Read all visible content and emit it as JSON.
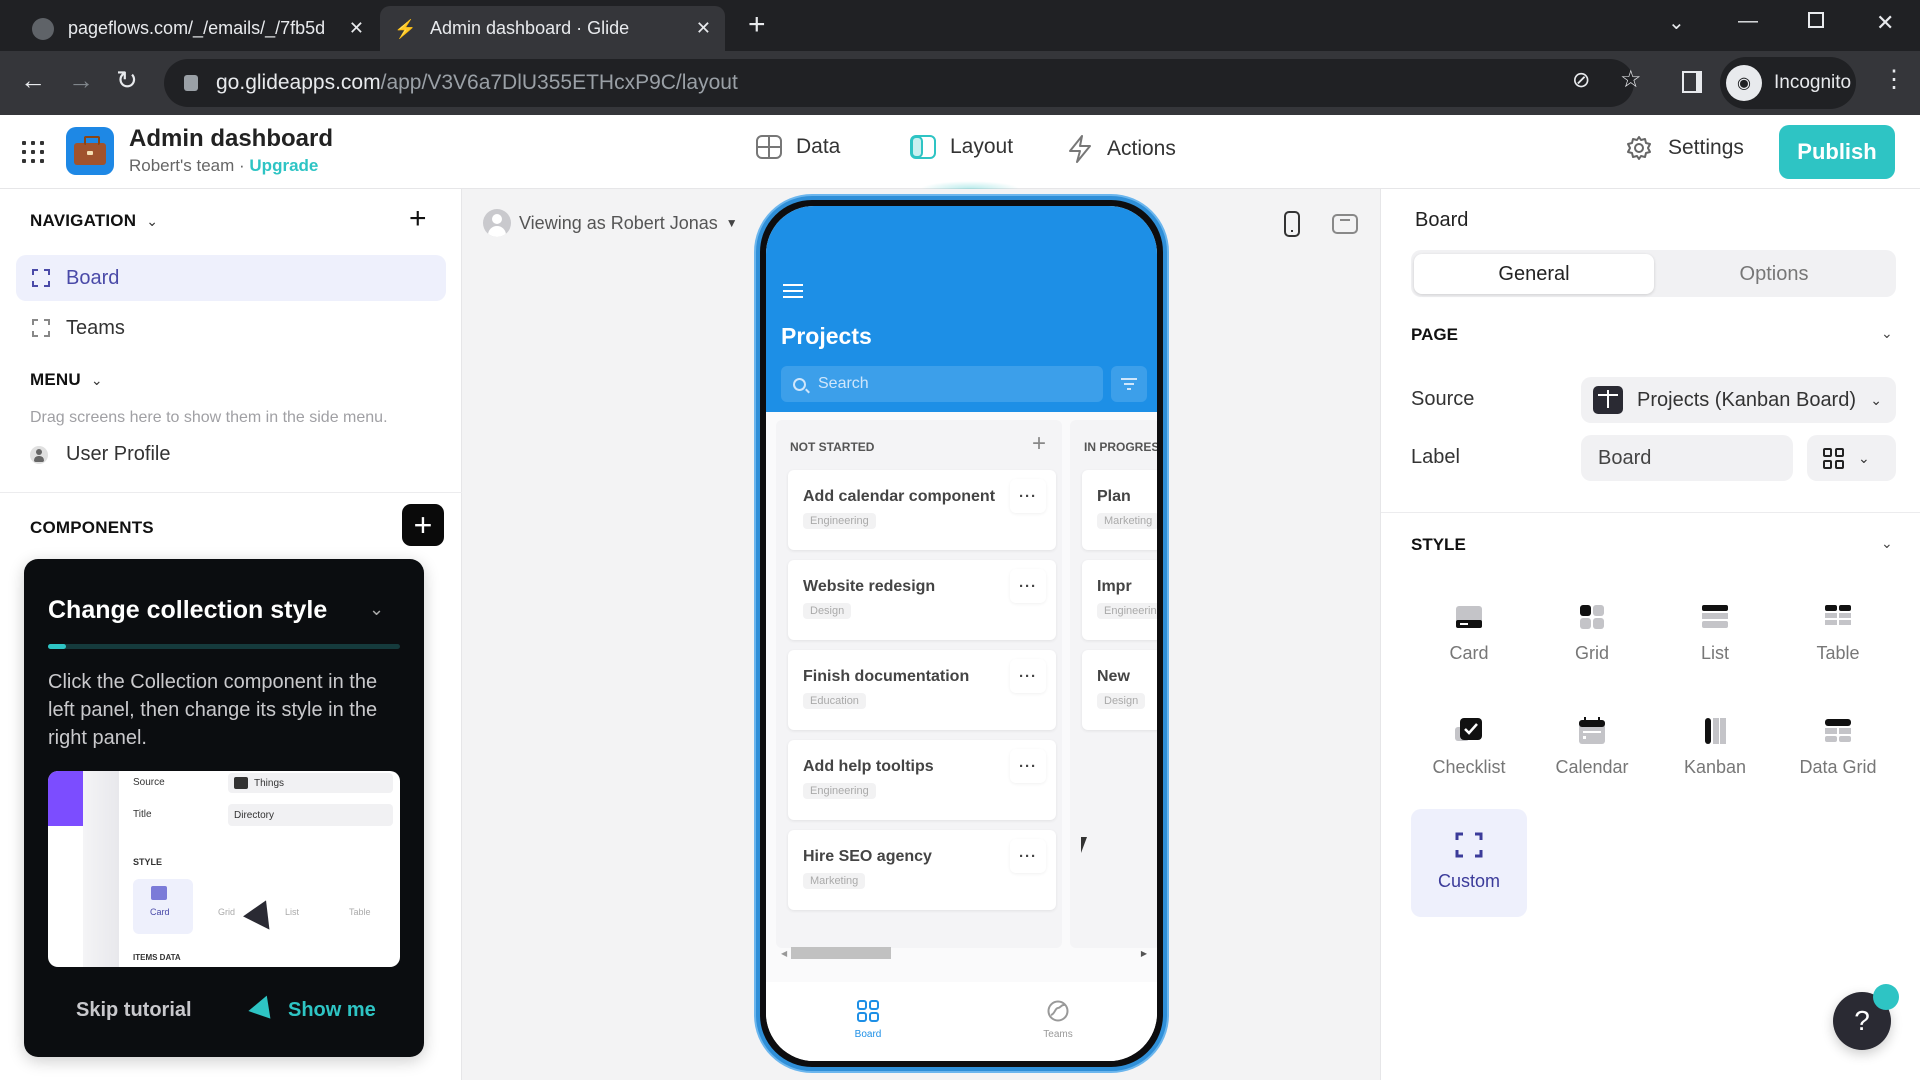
{
  "browser": {
    "tabs": [
      {
        "title": "pageflows.com/_/emails/_/7fb5d",
        "active": false,
        "icon": "globe-icon"
      },
      {
        "title": "Admin dashboard · Glide",
        "active": true,
        "icon": "glide-icon"
      }
    ],
    "url_host": "go.glideapps.com",
    "url_path": "/app/V3V6a7DlU355ETHcxP9C/layout",
    "profile_label": "Incognito"
  },
  "app": {
    "title": "Admin dashboard",
    "team": "Robert's team · ",
    "upgrade": "Upgrade",
    "nav": [
      {
        "label": "Data",
        "icon": "table-icon"
      },
      {
        "label": "Layout",
        "icon": "layout-icon",
        "active": true
      },
      {
        "label": "Actions",
        "icon": "lightning-icon"
      }
    ],
    "settings": "Settings",
    "publish": "Publish",
    "accent": "#2ec4c4"
  },
  "left": {
    "navigation_label": "NAVIGATION",
    "nav_items": [
      {
        "label": "Board",
        "selected": true
      },
      {
        "label": "Teams",
        "selected": false
      }
    ],
    "menu_label": "MENU",
    "menu_hint": "Drag screens here to show them in the side menu.",
    "menu_items": [
      {
        "label": "User Profile"
      }
    ],
    "components_label": "COMPONENTS"
  },
  "tutorial": {
    "title": "Change collection style",
    "progress": 0.05,
    "body": "Click the Collection component in the left panel, then change its style in the right panel.",
    "preview": {
      "source_label": "Source",
      "source_value": "Things",
      "title_label": "Title",
      "title_value": "Directory",
      "style_label": "STYLE",
      "styles": [
        "Card",
        "Grid",
        "List",
        "Table"
      ],
      "items_label": "ITEMS DATA"
    },
    "skip": "Skip tutorial",
    "show": "Show me"
  },
  "canvas": {
    "viewing_as": "Viewing as Robert Jonas"
  },
  "phone": {
    "title": "Projects",
    "search_placeholder": "Search",
    "columns": [
      {
        "name": "NOT STARTED",
        "cards": [
          {
            "title": "Add calendar component",
            "tag": "Engineering"
          },
          {
            "title": "Website redesign",
            "tag": "Design"
          },
          {
            "title": "Finish documentation",
            "tag": "Education"
          },
          {
            "title": "Add help tooltips",
            "tag": "Engineering"
          },
          {
            "title": "Hire SEO agency",
            "tag": "Marketing"
          }
        ]
      },
      {
        "name": "IN PROGRESS",
        "cards": [
          {
            "title": "Plan",
            "tag": "Marketing"
          },
          {
            "title": "Impr",
            "tag": "Engineering"
          },
          {
            "title": "New",
            "tag": "Design"
          }
        ]
      }
    ],
    "tabs": [
      {
        "label": "Board",
        "active": true
      },
      {
        "label": "Teams",
        "active": false
      }
    ]
  },
  "right": {
    "title": "Board",
    "segments": [
      "General",
      "Options"
    ],
    "page_label": "PAGE",
    "source_label": "Source",
    "source_value": "Projects (Kanban Board)",
    "label_label": "Label",
    "label_value": "Board",
    "style_label": "STYLE",
    "styles": [
      {
        "label": "Card"
      },
      {
        "label": "Grid"
      },
      {
        "label": "List"
      },
      {
        "label": "Table"
      },
      {
        "label": "Checklist"
      },
      {
        "label": "Calendar"
      },
      {
        "label": "Kanban"
      },
      {
        "label": "Data Grid"
      },
      {
        "label": "Custom",
        "selected": true
      }
    ],
    "help": "?"
  }
}
